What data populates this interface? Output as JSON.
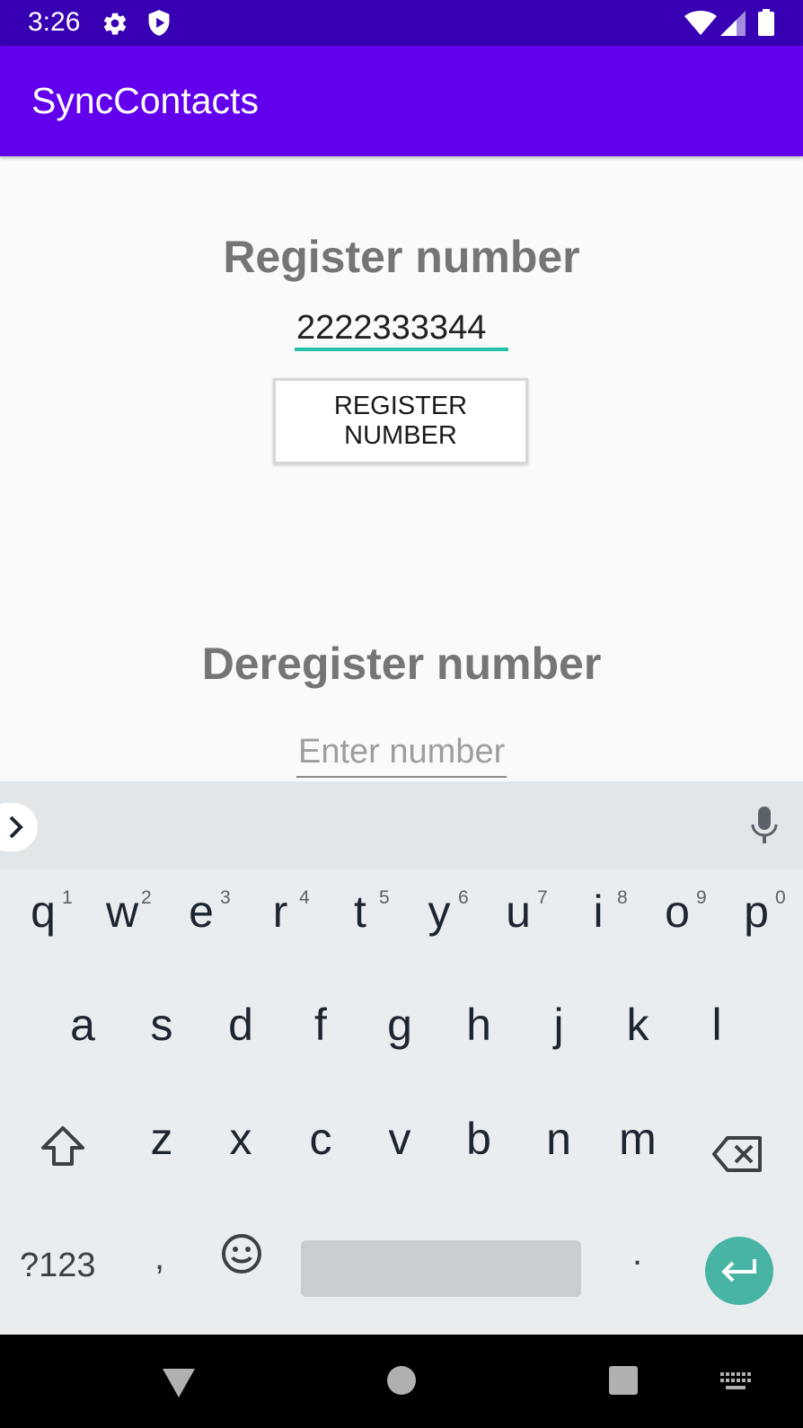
{
  "status_bar": {
    "time": "3:26",
    "icons": [
      "gear-icon",
      "shield-play-icon",
      "wifi-icon",
      "signal-icon",
      "battery-icon"
    ]
  },
  "app_bar": {
    "title": "SyncContacts",
    "color": "#6200ee"
  },
  "register": {
    "title": "Register number",
    "input_value": "2222333344",
    "button_label": "REGISTER NUMBER"
  },
  "deregister": {
    "title": "Deregister number",
    "input_placeholder": "Enter number"
  },
  "keyboard": {
    "row1": [
      {
        "key": "q",
        "hint": "1"
      },
      {
        "key": "w",
        "hint": "2"
      },
      {
        "key": "e",
        "hint": "3"
      },
      {
        "key": "r",
        "hint": "4"
      },
      {
        "key": "t",
        "hint": "5"
      },
      {
        "key": "y",
        "hint": "6"
      },
      {
        "key": "u",
        "hint": "7"
      },
      {
        "key": "i",
        "hint": "8"
      },
      {
        "key": "o",
        "hint": "9"
      },
      {
        "key": "p",
        "hint": "0"
      }
    ],
    "row2": [
      "a",
      "s",
      "d",
      "f",
      "g",
      "h",
      "j",
      "k",
      "l"
    ],
    "row3": [
      "z",
      "x",
      "c",
      "v",
      "b",
      "n",
      "m"
    ],
    "symbols_label": "?123",
    "comma_label": ",",
    "period_label": ".",
    "accent_color": "#48b4a4"
  },
  "nav_bar": {
    "icons": [
      "back-icon",
      "home-icon",
      "recents-icon",
      "keyboard-switch-icon"
    ]
  }
}
